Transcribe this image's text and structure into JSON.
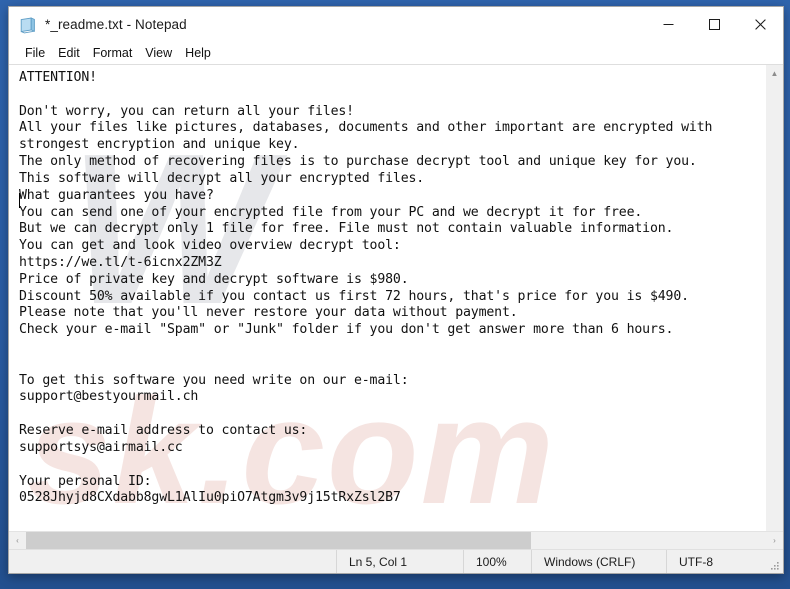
{
  "window": {
    "title": "*_readme.txt - Notepad",
    "icon": "notepad-icon",
    "controls": {
      "minimize": "—",
      "maximize": "☐",
      "close": "✕"
    }
  },
  "menu": {
    "items": [
      {
        "label": "File"
      },
      {
        "label": "Edit"
      },
      {
        "label": "Format"
      },
      {
        "label": "View"
      },
      {
        "label": "Help"
      }
    ]
  },
  "editor": {
    "content": "ATTENTION!\n\nDon't worry, you can return all your files!\nAll your files like pictures, databases, documents and other important are encrypted with\nstrongest encryption and unique key.\nThe only method of recovering files is to purchase decrypt tool and unique key for you.\nThis software will decrypt all your encrypted files.\nWhat guarantees you have?\nYou can send one of your encrypted file from your PC and we decrypt it for free.\nBut we can decrypt only 1 file for free. File must not contain valuable information.\nYou can get and look video overview decrypt tool:\nhttps://we.tl/t-6icnx2ZM3Z\nPrice of private key and decrypt software is $980.\nDiscount 50% available if you contact us first 72 hours, that's price for you is $490.\nPlease note that you'll never restore your data without payment.\nCheck your e-mail \"Spam\" or \"Junk\" folder if you don't get answer more than 6 hours.\n\n\nTo get this software you need write on our e-mail:\nsupport@bestyourmail.ch\n\nReserve e-mail address to contact us:\nsupportsys@airmail.cc\n\nYour personal ID:\n0528Jhyjd8CXdabb8gwL1AlIu0piO7Atgm3v9j15tRxZsl2B7",
    "watermark_primary": "W",
    "watermark_secondary": "sk.com"
  },
  "scrollbars": {
    "vertical_up": "▲",
    "vertical_down": "▼",
    "horizontal_left": "‹",
    "horizontal_right": "›"
  },
  "status_bar": {
    "cursor_position": "Ln 5, Col 1",
    "zoom": "100%",
    "line_ending": "Windows (CRLF)",
    "encoding": "UTF-8"
  },
  "colors": {
    "desktop": "#2a5ca3",
    "window_bg": "#ffffff",
    "status_bg": "#f0f0f0",
    "text": "#111111",
    "close_hover": "#e81123"
  }
}
